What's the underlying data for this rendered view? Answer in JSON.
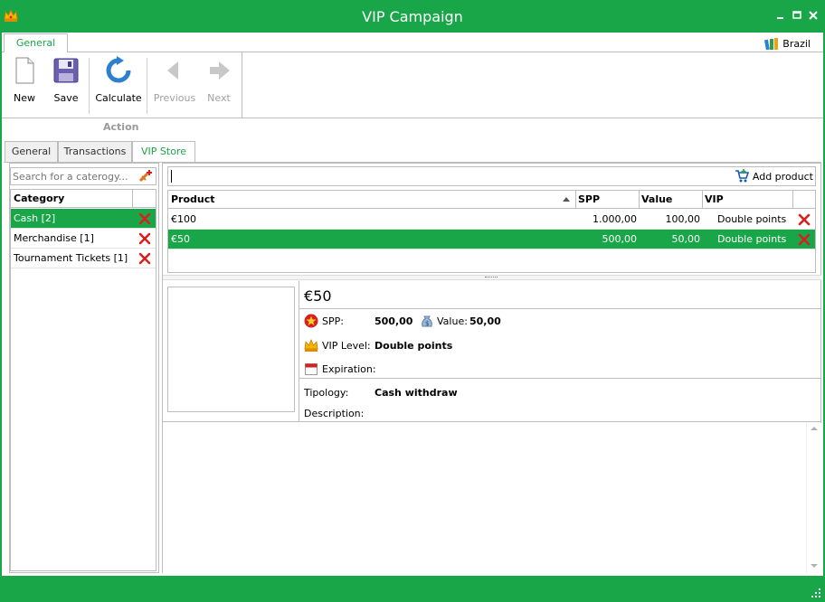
{
  "window": {
    "title": "VIP Campaign",
    "accent_color": "#19a649",
    "controls": [
      "minimize",
      "maximize",
      "close"
    ]
  },
  "ribbon": {
    "tab": "General",
    "language": "Brazil",
    "buttons": [
      {
        "label": "New",
        "icon": "new-document-icon",
        "enabled": true
      },
      {
        "label": "Save",
        "icon": "save-icon",
        "enabled": true
      },
      {
        "label": "Calculate",
        "icon": "refresh-icon",
        "enabled": true
      },
      {
        "label": "Previous",
        "icon": "arrow-left-icon",
        "enabled": false
      },
      {
        "label": "Next",
        "icon": "arrow-right-icon",
        "enabled": false
      }
    ],
    "group_label": "Action"
  },
  "content_tabs": [
    {
      "label": "General",
      "active": false
    },
    {
      "label": "Transactions",
      "active": false
    },
    {
      "label": "VIP Store",
      "active": true
    }
  ],
  "category_panel": {
    "search_placeholder": "Search for a caterogy...",
    "header": "Category",
    "rows": [
      {
        "label": "Cash [2]",
        "selected": true
      },
      {
        "label": "Merchandise [1]",
        "selected": false
      },
      {
        "label": "Tournament Tickets [1]",
        "selected": false
      }
    ]
  },
  "product_panel": {
    "search_value": "",
    "add_label": "Add product",
    "columns": [
      "Product",
      "SPP",
      "Value",
      "VIP"
    ],
    "rows": [
      {
        "product": "€100",
        "spp": "1.000,00",
        "value": "100,00",
        "vip": "Double points",
        "selected": false
      },
      {
        "product": "€50",
        "spp": "500,00",
        "value": "50,00",
        "vip": "Double points",
        "selected": true
      }
    ]
  },
  "detail": {
    "title": "€50",
    "spp_label": "SPP:",
    "spp_value": "500,00",
    "value_label": "Value:",
    "value_value": "50,00",
    "vip_level_label": "VIP Level:",
    "vip_level_value": "Double points",
    "expiration_label": "Expiration:",
    "expiration_value": "",
    "tipology_label": "Tipology:",
    "tipology_value": "Cash withdraw",
    "description_label": "Description:",
    "description_value": ""
  }
}
